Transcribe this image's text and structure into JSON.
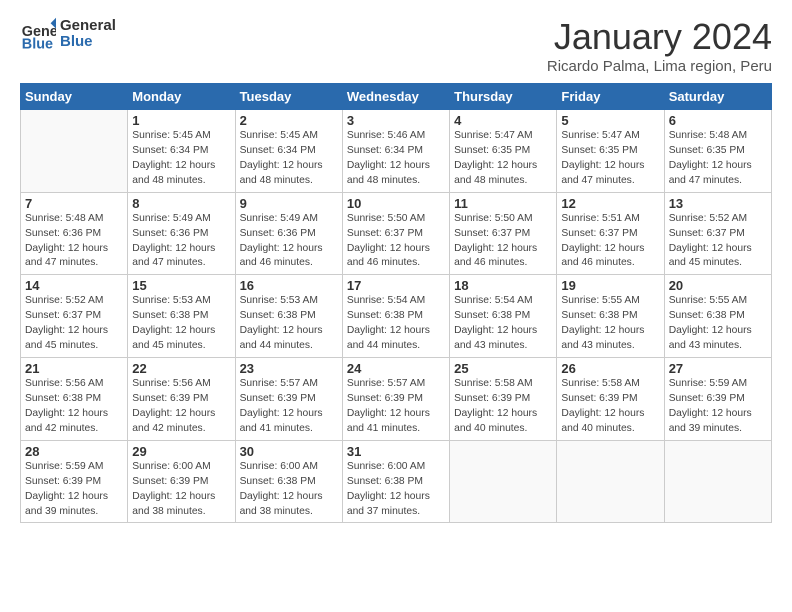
{
  "header": {
    "logo_line1": "General",
    "logo_line2": "Blue",
    "title": "January 2024",
    "subtitle": "Ricardo Palma, Lima region, Peru"
  },
  "weekdays": [
    "Sunday",
    "Monday",
    "Tuesday",
    "Wednesday",
    "Thursday",
    "Friday",
    "Saturday"
  ],
  "weeks": [
    [
      {
        "day": "",
        "sunrise": "",
        "sunset": "",
        "daylight": ""
      },
      {
        "day": "1",
        "sunrise": "5:45 AM",
        "sunset": "6:34 PM",
        "daylight": "12 hours and 48 minutes."
      },
      {
        "day": "2",
        "sunrise": "5:45 AM",
        "sunset": "6:34 PM",
        "daylight": "12 hours and 48 minutes."
      },
      {
        "day": "3",
        "sunrise": "5:46 AM",
        "sunset": "6:34 PM",
        "daylight": "12 hours and 48 minutes."
      },
      {
        "day": "4",
        "sunrise": "5:47 AM",
        "sunset": "6:35 PM",
        "daylight": "12 hours and 48 minutes."
      },
      {
        "day": "5",
        "sunrise": "5:47 AM",
        "sunset": "6:35 PM",
        "daylight": "12 hours and 47 minutes."
      },
      {
        "day": "6",
        "sunrise": "5:48 AM",
        "sunset": "6:35 PM",
        "daylight": "12 hours and 47 minutes."
      }
    ],
    [
      {
        "day": "7",
        "sunrise": "5:48 AM",
        "sunset": "6:36 PM",
        "daylight": "12 hours and 47 minutes."
      },
      {
        "day": "8",
        "sunrise": "5:49 AM",
        "sunset": "6:36 PM",
        "daylight": "12 hours and 47 minutes."
      },
      {
        "day": "9",
        "sunrise": "5:49 AM",
        "sunset": "6:36 PM",
        "daylight": "12 hours and 46 minutes."
      },
      {
        "day": "10",
        "sunrise": "5:50 AM",
        "sunset": "6:37 PM",
        "daylight": "12 hours and 46 minutes."
      },
      {
        "day": "11",
        "sunrise": "5:50 AM",
        "sunset": "6:37 PM",
        "daylight": "12 hours and 46 minutes."
      },
      {
        "day": "12",
        "sunrise": "5:51 AM",
        "sunset": "6:37 PM",
        "daylight": "12 hours and 46 minutes."
      },
      {
        "day": "13",
        "sunrise": "5:52 AM",
        "sunset": "6:37 PM",
        "daylight": "12 hours and 45 minutes."
      }
    ],
    [
      {
        "day": "14",
        "sunrise": "5:52 AM",
        "sunset": "6:37 PM",
        "daylight": "12 hours and 45 minutes."
      },
      {
        "day": "15",
        "sunrise": "5:53 AM",
        "sunset": "6:38 PM",
        "daylight": "12 hours and 45 minutes."
      },
      {
        "day": "16",
        "sunrise": "5:53 AM",
        "sunset": "6:38 PM",
        "daylight": "12 hours and 44 minutes."
      },
      {
        "day": "17",
        "sunrise": "5:54 AM",
        "sunset": "6:38 PM",
        "daylight": "12 hours and 44 minutes."
      },
      {
        "day": "18",
        "sunrise": "5:54 AM",
        "sunset": "6:38 PM",
        "daylight": "12 hours and 43 minutes."
      },
      {
        "day": "19",
        "sunrise": "5:55 AM",
        "sunset": "6:38 PM",
        "daylight": "12 hours and 43 minutes."
      },
      {
        "day": "20",
        "sunrise": "5:55 AM",
        "sunset": "6:38 PM",
        "daylight": "12 hours and 43 minutes."
      }
    ],
    [
      {
        "day": "21",
        "sunrise": "5:56 AM",
        "sunset": "6:38 PM",
        "daylight": "12 hours and 42 minutes."
      },
      {
        "day": "22",
        "sunrise": "5:56 AM",
        "sunset": "6:39 PM",
        "daylight": "12 hours and 42 minutes."
      },
      {
        "day": "23",
        "sunrise": "5:57 AM",
        "sunset": "6:39 PM",
        "daylight": "12 hours and 41 minutes."
      },
      {
        "day": "24",
        "sunrise": "5:57 AM",
        "sunset": "6:39 PM",
        "daylight": "12 hours and 41 minutes."
      },
      {
        "day": "25",
        "sunrise": "5:58 AM",
        "sunset": "6:39 PM",
        "daylight": "12 hours and 40 minutes."
      },
      {
        "day": "26",
        "sunrise": "5:58 AM",
        "sunset": "6:39 PM",
        "daylight": "12 hours and 40 minutes."
      },
      {
        "day": "27",
        "sunrise": "5:59 AM",
        "sunset": "6:39 PM",
        "daylight": "12 hours and 39 minutes."
      }
    ],
    [
      {
        "day": "28",
        "sunrise": "5:59 AM",
        "sunset": "6:39 PM",
        "daylight": "12 hours and 39 minutes."
      },
      {
        "day": "29",
        "sunrise": "6:00 AM",
        "sunset": "6:39 PM",
        "daylight": "12 hours and 38 minutes."
      },
      {
        "day": "30",
        "sunrise": "6:00 AM",
        "sunset": "6:38 PM",
        "daylight": "12 hours and 38 minutes."
      },
      {
        "day": "31",
        "sunrise": "6:00 AM",
        "sunset": "6:38 PM",
        "daylight": "12 hours and 37 minutes."
      },
      {
        "day": "",
        "sunrise": "",
        "sunset": "",
        "daylight": ""
      },
      {
        "day": "",
        "sunrise": "",
        "sunset": "",
        "daylight": ""
      },
      {
        "day": "",
        "sunrise": "",
        "sunset": "",
        "daylight": ""
      }
    ]
  ]
}
